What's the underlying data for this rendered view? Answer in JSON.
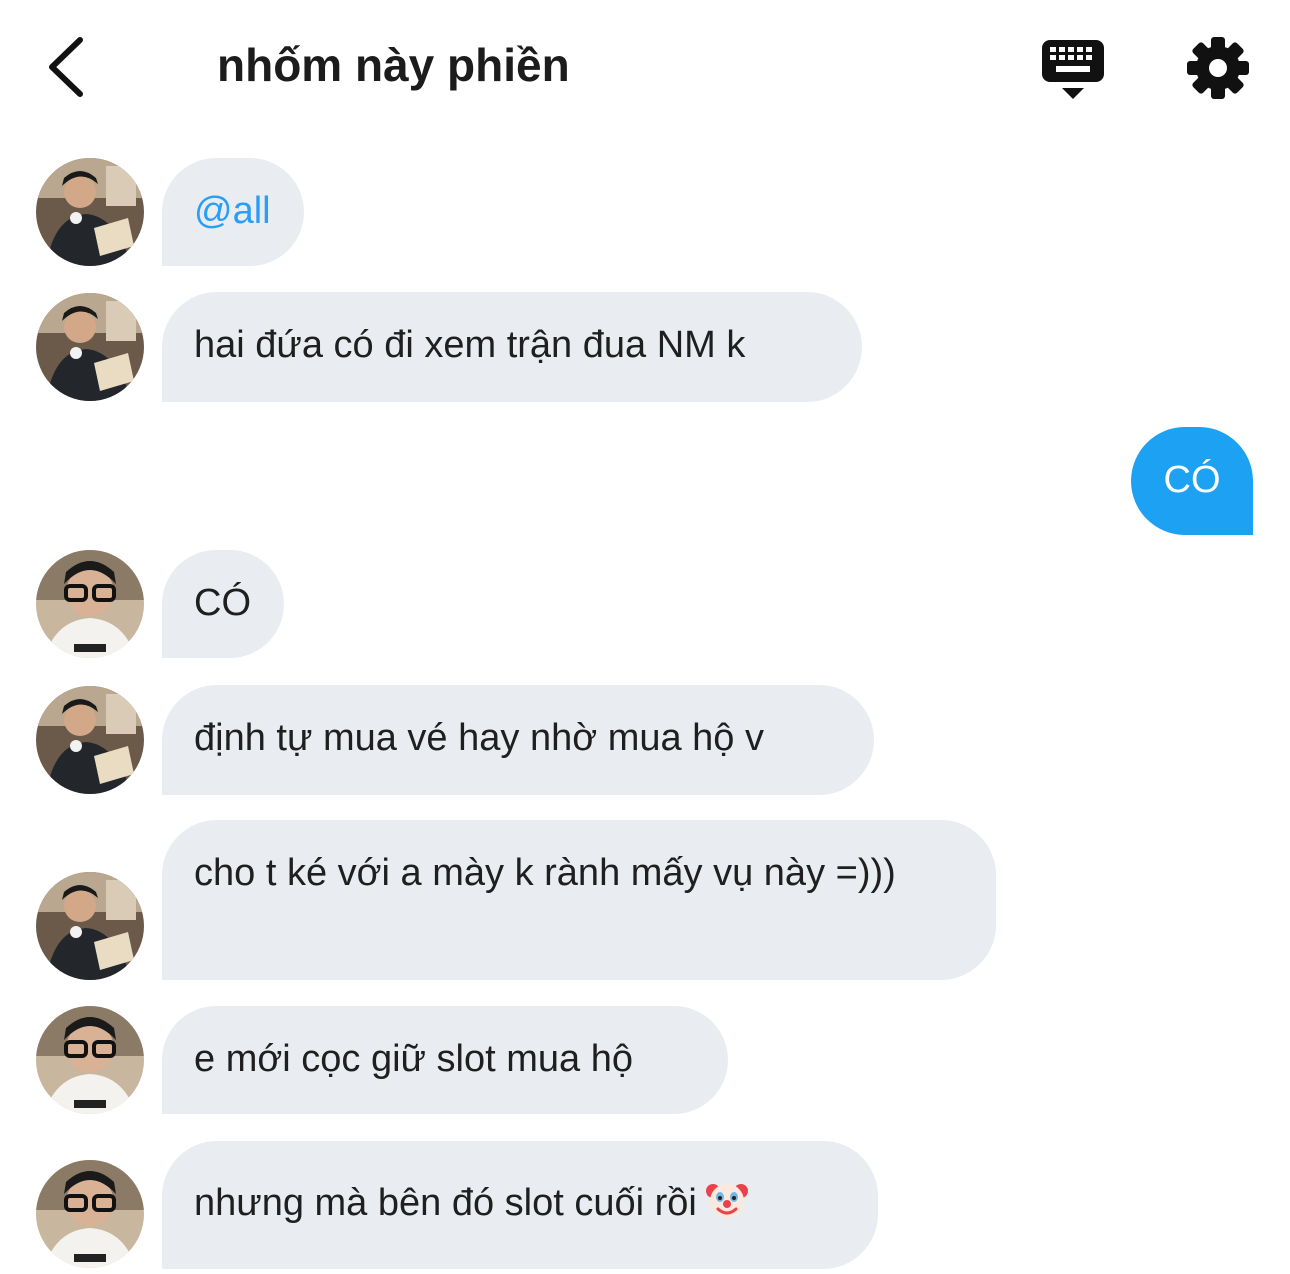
{
  "header": {
    "title": "nhốm này phiền"
  },
  "messages": [
    {
      "text": "@all"
    },
    {
      "text": "hai đứa có đi xem trận đua NM k"
    },
    {
      "text": "CÓ"
    },
    {
      "text": "CÓ"
    },
    {
      "text": "định tự mua vé hay nhờ mua hộ v"
    },
    {
      "text": "cho t ké với a mày k rành mấy vụ này =)))"
    },
    {
      "text": "e mới cọc giữ slot mua hộ"
    },
    {
      "text": "nhưng mà bên đó slot cuối rồi",
      "emoji": "clown-face"
    }
  ],
  "colors": {
    "received_bubble": "#e9edf1",
    "sent_bubble": "#1da1f2",
    "mention": "#2a9df4"
  }
}
